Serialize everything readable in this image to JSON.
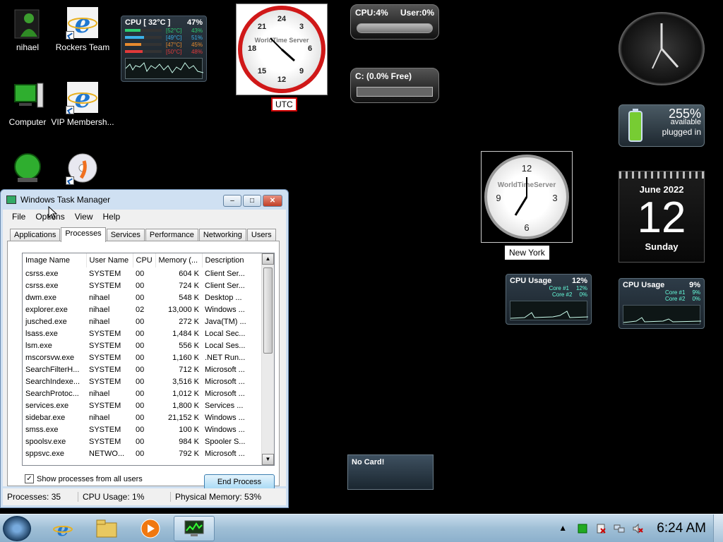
{
  "desktop_icons": [
    {
      "label": "nihael"
    },
    {
      "label": "Rockers Team"
    },
    {
      "label": "Computer"
    },
    {
      "label": "VIP Membersh..."
    }
  ],
  "cpu_meter": {
    "title": "CPU [ 32°C ]",
    "percent": "47%",
    "cores": [
      {
        "temp": "[52°C]",
        "pct": "43%",
        "fill": 0.43,
        "color": "#2ecc71"
      },
      {
        "temp": "[49°C]",
        "pct": "51%",
        "fill": 0.51,
        "color": "#3ab0e8"
      },
      {
        "temp": "[47°C]",
        "pct": "45%",
        "fill": 0.45,
        "color": "#e68a2e"
      },
      {
        "temp": "[50°C]",
        "pct": "48%",
        "fill": 0.48,
        "color": "#e03a3a"
      }
    ]
  },
  "utc_clock": {
    "brand": "WorldTime Server",
    "label": "UTC"
  },
  "cpu_pill": {
    "cpu": "CPU:4%",
    "user": "User:0%"
  },
  "disk_pill": {
    "text": "C: (0.0% Free)"
  },
  "ny_clock": {
    "brand": "WorldTimeServer",
    "label": "New York"
  },
  "battery": {
    "percent": "255%",
    "available": "available",
    "status": "plugged in"
  },
  "calendar": {
    "month_year": "June 2022",
    "day": "12",
    "weekday": "Sunday"
  },
  "cpu_usage_1": {
    "title": "CPU Usage",
    "pct": "12%",
    "core1": "Core #1",
    "core1_pct": "12%",
    "core2": "Core #2",
    "core2_pct": "0%"
  },
  "cpu_usage_2": {
    "title": "CPU Usage",
    "pct": "9%",
    "core1": "Core #1",
    "core1_pct": "9%",
    "core2": "Core #2",
    "core2_pct": "0%"
  },
  "nocard": {
    "text": "No Card!"
  },
  "task_manager": {
    "title": "Windows Task Manager",
    "menu": [
      "File",
      "Options",
      "View",
      "Help"
    ],
    "tabs": [
      "Applications",
      "Processes",
      "Services",
      "Performance",
      "Networking",
      "Users"
    ],
    "columns": [
      "Image Name",
      "User Name",
      "CPU",
      "Memory (...",
      "Description"
    ],
    "rows": [
      [
        "csrss.exe",
        "SYSTEM",
        "00",
        "604 K",
        "Client Ser..."
      ],
      [
        "csrss.exe",
        "SYSTEM",
        "00",
        "724 K",
        "Client Ser..."
      ],
      [
        "dwm.exe",
        "nihael",
        "00",
        "548 K",
        "Desktop ..."
      ],
      [
        "explorer.exe",
        "nihael",
        "02",
        "13,000 K",
        "Windows ..."
      ],
      [
        "jusched.exe",
        "nihael",
        "00",
        "272 K",
        "Java(TM) ..."
      ],
      [
        "lsass.exe",
        "SYSTEM",
        "00",
        "1,484 K",
        "Local Sec..."
      ],
      [
        "lsm.exe",
        "SYSTEM",
        "00",
        "556 K",
        "Local Ses..."
      ],
      [
        "mscorsvw.exe",
        "SYSTEM",
        "00",
        "1,160 K",
        ".NET Run..."
      ],
      [
        "SearchFilterH...",
        "SYSTEM",
        "00",
        "712 K",
        "Microsoft ..."
      ],
      [
        "SearchIndexe...",
        "SYSTEM",
        "00",
        "3,516 K",
        "Microsoft ..."
      ],
      [
        "SearchProtoc...",
        "nihael",
        "00",
        "1,012 K",
        "Microsoft ..."
      ],
      [
        "services.exe",
        "SYSTEM",
        "00",
        "1,800 K",
        "Services ..."
      ],
      [
        "sidebar.exe",
        "nihael",
        "00",
        "21,152 K",
        "Windows ..."
      ],
      [
        "smss.exe",
        "SYSTEM",
        "00",
        "100 K",
        "Windows ..."
      ],
      [
        "spoolsv.exe",
        "SYSTEM",
        "00",
        "984 K",
        "Spooler S..."
      ],
      [
        "sppsvc.exe",
        "NETWO...",
        "00",
        "792 K",
        "Microsoft ..."
      ]
    ],
    "show_all_label": "Show processes from all users",
    "show_all_checked": true,
    "end_process_label": "End Process",
    "status": {
      "processes": "Processes: 35",
      "cpu": "CPU Usage: 1%",
      "memory": "Physical Memory: 53%"
    }
  },
  "taskbar": {
    "clock": "6:24 AM"
  }
}
